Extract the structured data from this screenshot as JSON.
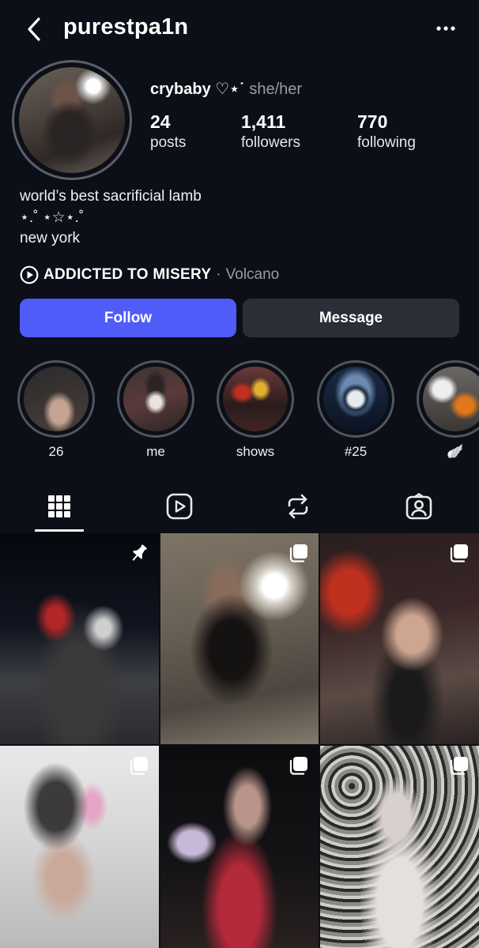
{
  "header": {
    "username": "purestpa1n",
    "back_icon": "chevron-left-icon",
    "more_icon": "more-horizontal-icon"
  },
  "profile": {
    "display_name": "crybaby ♡⋆˙",
    "pronouns": "she/her",
    "stats": [
      {
        "value": "24",
        "label": "posts"
      },
      {
        "value": "1,411",
        "label": "followers"
      },
      {
        "value": "770",
        "label": "following"
      }
    ],
    "bio": {
      "line1": "world’s best sacrificial lamb",
      "line2": "⋆.˚ ⋆☆⋆.˚",
      "line3": "new york"
    },
    "music": {
      "title": "ADDICTED TO MISERY",
      "separator": "·",
      "artist": "Volcano"
    }
  },
  "actions": {
    "follow_label": "Follow",
    "message_label": "Message",
    "follow_color": "#4f5cf8",
    "message_color": "#2b2e37"
  },
  "highlights": [
    {
      "label": "26"
    },
    {
      "label": "me"
    },
    {
      "label": "shows"
    },
    {
      "label": "#25"
    },
    {
      "label": "🪽"
    }
  ],
  "tabs": [
    {
      "name": "grid",
      "icon": "grid-icon",
      "active": true
    },
    {
      "name": "reels",
      "icon": "reels-icon",
      "active": false
    },
    {
      "name": "reposts",
      "icon": "repost-icon",
      "active": false
    },
    {
      "name": "tagged",
      "icon": "tagged-user-icon",
      "active": false
    }
  ],
  "posts": [
    {
      "badge": "pin-icon"
    },
    {
      "badge": "carousel-icon"
    },
    {
      "badge": "carousel-icon"
    },
    {
      "badge": "carousel-icon"
    },
    {
      "badge": "carousel-icon"
    },
    {
      "badge": "carousel-icon"
    }
  ]
}
